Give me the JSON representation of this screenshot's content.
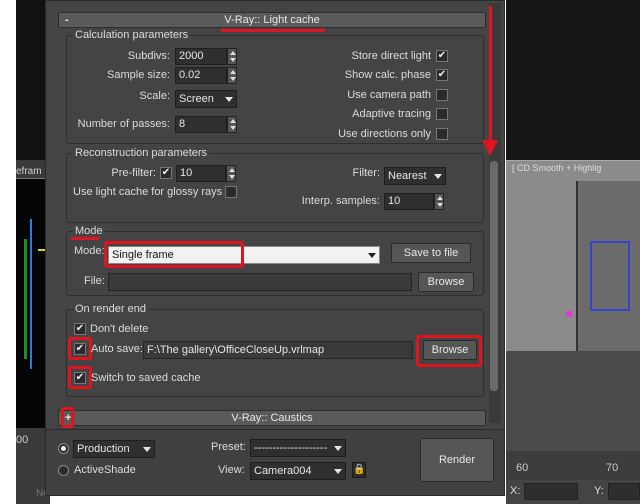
{
  "background": {
    "left_label": "efram",
    "left_number": "00",
    "left_status": "None Selected",
    "right_label": "[ CD Smooth + Highlig",
    "ruler": [
      "60",
      "70"
    ],
    "coord_x_label": "X:",
    "coord_y_label": "Y:"
  },
  "light_cache": {
    "title": "V-Ray:: Light cache",
    "toggle": "-",
    "calc": {
      "title": "Calculation parameters",
      "subdivs_label": "Subdivs:",
      "subdivs_value": "2000",
      "sample_size_label": "Sample size:",
      "sample_size_value": "0.02",
      "scale_label": "Scale:",
      "scale_value": "Screen",
      "passes_label": "Number of passes:",
      "passes_value": "8",
      "store_direct_label": "Store direct light",
      "store_direct_checked": true,
      "show_phase_label": "Show calc. phase",
      "show_phase_checked": true,
      "camera_path_label": "Use camera path",
      "camera_path_checked": false,
      "adaptive_label": "Adaptive tracing",
      "adaptive_checked": false,
      "directions_label": "Use directions only",
      "directions_checked": false
    },
    "recon": {
      "title": "Reconstruction parameters",
      "prefilter_label": "Pre-filter:",
      "prefilter_checked": true,
      "prefilter_value": "10",
      "glossy_label": "Use light cache for glossy rays",
      "glossy_checked": false,
      "filter_label": "Filter:",
      "filter_value": "Nearest",
      "interp_label": "Interp. samples:",
      "interp_value": "10"
    },
    "mode": {
      "title": "Mode",
      "mode_label": "Mode:",
      "mode_value": "Single frame",
      "save_button": "Save to file",
      "file_label": "File:",
      "file_value": "",
      "browse_button": "Browse"
    },
    "render_end": {
      "title": "On render end",
      "dont_delete_label": "Don't delete",
      "dont_delete_checked": true,
      "auto_save_label": "Auto save:",
      "auto_save_checked": true,
      "auto_save_path": "F:\\The gallery\\OfficeCloseUp.vrlmap",
      "browse_button": "Browse",
      "switch_label": "Switch to saved cache",
      "switch_checked": true
    }
  },
  "caustics": {
    "title": "V-Ray:: Caustics",
    "toggle": "+"
  },
  "bottom": {
    "production_label": "Production",
    "activeshade_label": "ActiveShade",
    "preset_label": "Preset:",
    "preset_value": "--------------------",
    "view_label": "View:",
    "view_value": "Camera004",
    "render_button": "Render"
  },
  "colors": {
    "dialog_bg": "#444444",
    "highlight": "#e0141f",
    "text": "#dcdcdc"
  }
}
